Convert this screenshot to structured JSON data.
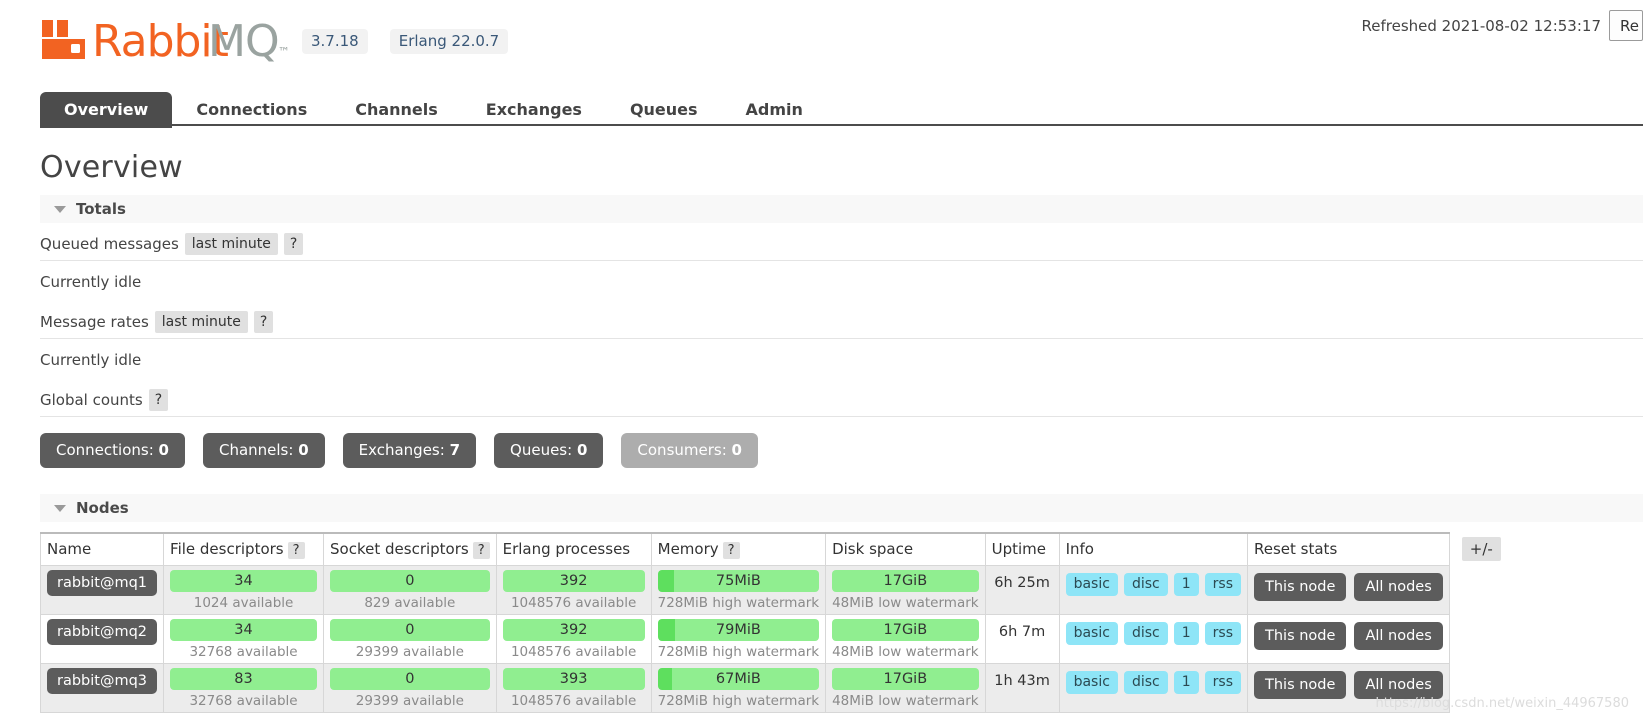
{
  "header": {
    "product": "RabbitMQ",
    "trademark": "™",
    "version": "3.7.18",
    "erlang": "Erlang 22.0.7",
    "refreshed_label": "Refreshed 2021-08-02 12:53:17",
    "refresh_button": "Re"
  },
  "nav": {
    "items": [
      {
        "label": "Overview",
        "active": true
      },
      {
        "label": "Connections",
        "active": false
      },
      {
        "label": "Channels",
        "active": false
      },
      {
        "label": "Exchanges",
        "active": false
      },
      {
        "label": "Queues",
        "active": false
      },
      {
        "label": "Admin",
        "active": false
      }
    ]
  },
  "page": {
    "title": "Overview"
  },
  "totals": {
    "section_label": "Totals",
    "queued_messages_label": "Queued messages",
    "queued_messages_period": "last minute",
    "help": "?",
    "queued_messages_status": "Currently idle",
    "message_rates_label": "Message rates",
    "message_rates_period": "last minute",
    "message_rates_status": "Currently idle",
    "global_counts_label": "Global counts",
    "counts": [
      {
        "label": "Connections:",
        "value": "0",
        "muted": false
      },
      {
        "label": "Channels:",
        "value": "0",
        "muted": false
      },
      {
        "label": "Exchanges:",
        "value": "7",
        "muted": false
      },
      {
        "label": "Queues:",
        "value": "0",
        "muted": false
      },
      {
        "label": "Consumers:",
        "value": "0",
        "muted": true
      }
    ]
  },
  "nodes": {
    "section_label": "Nodes",
    "columns": [
      "Name",
      "File descriptors",
      "Socket descriptors",
      "Erlang processes",
      "Memory",
      "Disk space",
      "Uptime",
      "Info",
      "Reset stats"
    ],
    "plusminus": "+/-",
    "help": "?",
    "reset_this": "This node",
    "reset_all": "All nodes",
    "rows": [
      {
        "name": "rabbit@mq1",
        "file_descriptors": "34",
        "file_descriptors_sub": "1024 available",
        "socket_descriptors": "0",
        "socket_descriptors_sub": "829 available",
        "erlang_processes": "392",
        "erlang_processes_sub": "1048576 available",
        "memory": "75MiB",
        "memory_fill_pct": 10,
        "memory_sub": "728MiB high watermark",
        "disk": "17GiB",
        "disk_sub": "48MiB low watermark",
        "uptime": "6h 25m",
        "info": [
          "basic",
          "disc",
          "1",
          "rss"
        ]
      },
      {
        "name": "rabbit@mq2",
        "file_descriptors": "34",
        "file_descriptors_sub": "32768 available",
        "socket_descriptors": "0",
        "socket_descriptors_sub": "29399 available",
        "erlang_processes": "392",
        "erlang_processes_sub": "1048576 available",
        "memory": "79MiB",
        "memory_fill_pct": 11,
        "memory_sub": "728MiB high watermark",
        "disk": "17GiB",
        "disk_sub": "48MiB low watermark",
        "uptime": "6h 7m",
        "info": [
          "basic",
          "disc",
          "1",
          "rss"
        ]
      },
      {
        "name": "rabbit@mq3",
        "file_descriptors": "83",
        "file_descriptors_sub": "32768 available",
        "socket_descriptors": "0",
        "socket_descriptors_sub": "29399 available",
        "erlang_processes": "393",
        "erlang_processes_sub": "1048576 available",
        "memory": "67MiB",
        "memory_fill_pct": 9,
        "memory_sub": "728MiB high watermark",
        "disk": "17GiB",
        "disk_sub": "48MiB low watermark",
        "uptime": "1h 43m",
        "info": [
          "basic",
          "disc",
          "1",
          "rss"
        ]
      }
    ]
  },
  "watermark": "https://blog.csdn.net/weixin_44967580",
  "colors": {
    "brand_orange": "#f26322",
    "brand_gray": "#9aa3a0",
    "dark": "#5c5c5c",
    "bar_green": "#90ee90",
    "bar_fill": "#5edf5e",
    "info_badge": "#8ee5f7"
  }
}
